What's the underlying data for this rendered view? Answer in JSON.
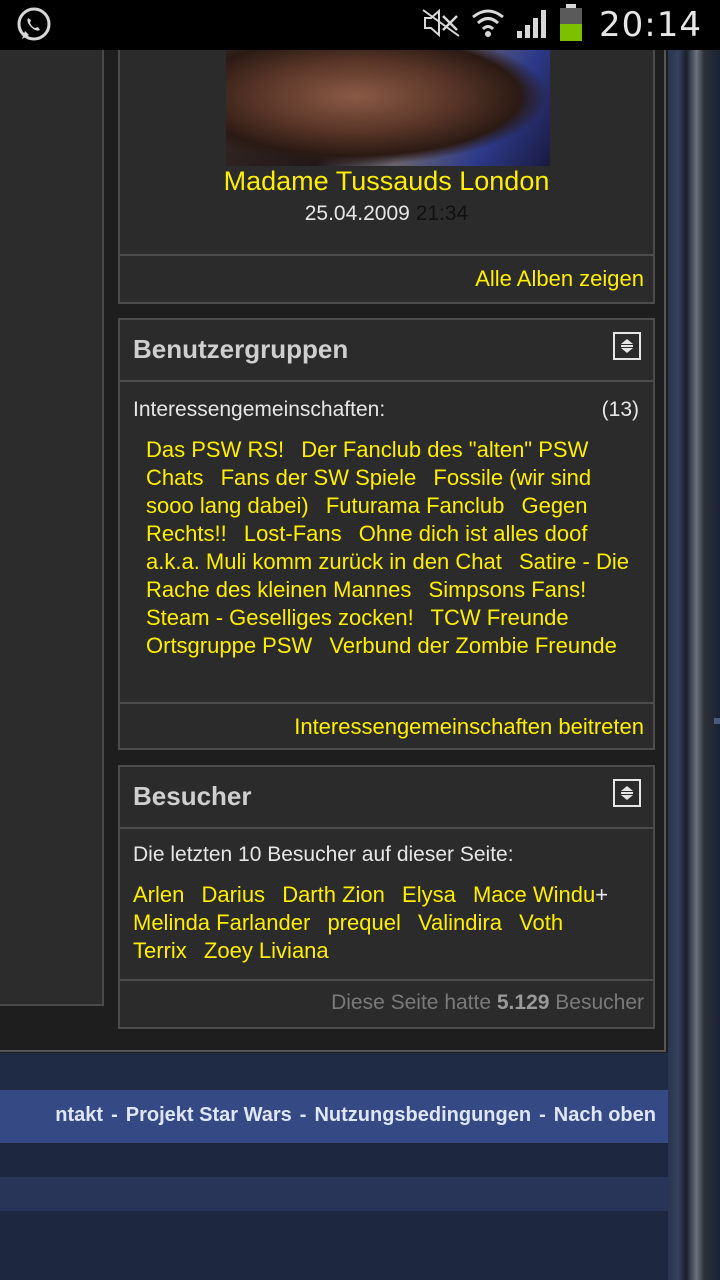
{
  "status_bar": {
    "time": "20:14",
    "icons": [
      "whatsapp-icon",
      "mute-icon",
      "wifi-icon",
      "signal-icon",
      "battery-icon"
    ],
    "battery_color": "#7cc000"
  },
  "photo": {
    "title": "Madame Tussauds London",
    "date": "25.04.2009",
    "time": "21:34",
    "all_albums_link": "Alle Alben zeigen"
  },
  "groups": {
    "title": "Benutzergruppen",
    "label": "Interessengemeinschaften:",
    "count": "(13)",
    "items": [
      "Das PSW RS!",
      "Der Fanclub des \"alten\" PSW Chats",
      "Fans der SW Spiele",
      "Fossile (wir sind sooo lang dabei)",
      "Futurama Fanclub",
      "Gegen Rechts!!",
      "Lost-Fans",
      "Ohne dich ist alles doof a.k.a. Muli komm zurück in den Chat",
      "Satire - Die Rache des kleinen Mannes",
      "Simpsons Fans!",
      "Steam - Geselliges zocken!",
      "TCW Freunde Ortsgruppe PSW",
      "Verbund der Zombie Freunde"
    ],
    "join_link": "Interessengemeinschaften beitreten"
  },
  "visitors": {
    "title": "Besucher",
    "label": "Die letzten 10 Besucher auf dieser Seite:",
    "names": [
      "Arlen",
      "Darius",
      "Darth Zion",
      "Elysa",
      "Mace Windu",
      "Melinda Farlander",
      "prequel",
      "Valindira",
      "Voth Terrix",
      "Zoey Liviana"
    ],
    "plus_marker": "+",
    "footer_prefix": "Diese Seite hatte",
    "footer_count": "5.129",
    "footer_suffix": "Besucher"
  },
  "footer_nav": {
    "items": [
      "ntakt",
      "Projekt Star Wars",
      "Nutzungsbedingungen",
      "Nach oben"
    ],
    "separator": "-"
  },
  "colors": {
    "link": "#ffee00",
    "panel_bg": "#2b2b2b",
    "footer_bar": "#354a85"
  }
}
